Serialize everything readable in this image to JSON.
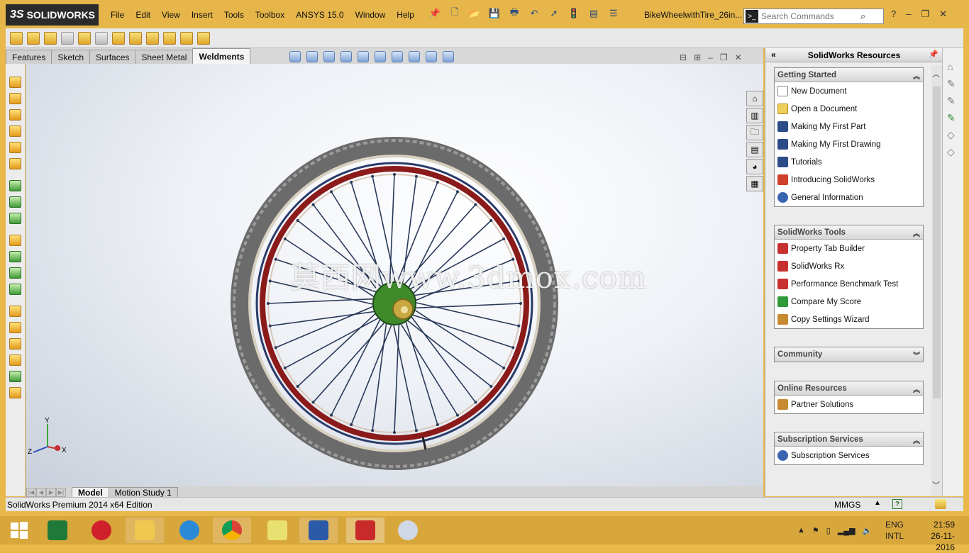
{
  "app": {
    "logo_text": "SOLIDWORKS",
    "logo_mark": "3S",
    "doc_title": "BikeWheelwithTire_26in...",
    "search_placeholder": "Search Commands"
  },
  "menu": [
    "File",
    "Edit",
    "View",
    "Insert",
    "Tools",
    "Toolbox",
    "ANSYS 15.0",
    "Window",
    "Help"
  ],
  "command_tabs": [
    {
      "label": "Features",
      "active": false
    },
    {
      "label": "Sketch",
      "active": false
    },
    {
      "label": "Surfaces",
      "active": false
    },
    {
      "label": "Sheet Metal",
      "active": false
    },
    {
      "label": "Weldments",
      "active": true
    }
  ],
  "viewport": {
    "watermark": "莫西网www.3dmox.com",
    "triad": {
      "x": "X",
      "y": "Y",
      "z": "Z"
    }
  },
  "bottom_tabs": [
    {
      "label": "Model",
      "active": true
    },
    {
      "label": "Motion Study 1",
      "active": false
    }
  ],
  "task_pane": {
    "title": "SolidWorks Resources",
    "groups": [
      {
        "title": "Getting Started",
        "collapsed": false,
        "items": [
          {
            "label": "New Document",
            "icon": "new-document-icon"
          },
          {
            "label": "Open a Document",
            "icon": "open-folder-icon"
          },
          {
            "label": "Making My First Part",
            "icon": "graduation-cap-icon"
          },
          {
            "label": "Making My First Drawing",
            "icon": "graduation-cap-icon"
          },
          {
            "label": "Tutorials",
            "icon": "graduation-cap-icon"
          },
          {
            "label": "Introducing SolidWorks",
            "icon": "solidworks-icon"
          },
          {
            "label": "General Information",
            "icon": "info-icon"
          }
        ]
      },
      {
        "title": "SolidWorks Tools",
        "collapsed": false,
        "items": [
          {
            "label": "Property Tab Builder",
            "icon": "property-tab-icon"
          },
          {
            "label": "SolidWorks Rx",
            "icon": "rx-icon"
          },
          {
            "label": "Performance Benchmark Test",
            "icon": "benchmark-icon"
          },
          {
            "label": "Compare My Score",
            "icon": "compare-score-icon"
          },
          {
            "label": "Copy Settings Wizard",
            "icon": "copy-settings-icon"
          }
        ]
      },
      {
        "title": "Community",
        "collapsed": true,
        "items": []
      },
      {
        "title": "Online Resources",
        "collapsed": false,
        "items": [
          {
            "label": "Partner Solutions",
            "icon": "partner-icon"
          }
        ]
      },
      {
        "title": "Subscription Services",
        "collapsed": false,
        "items": [
          {
            "label": "Subscription Services",
            "icon": "subscription-icon"
          }
        ]
      }
    ]
  },
  "status": {
    "text": "SolidWorks Premium 2014 x64 Edition",
    "units": "MMGS",
    "help_glyph": "?"
  },
  "taskbar": {
    "lang_top": "ENG",
    "lang_bottom": "INTL",
    "time": "21:59",
    "date": "26-11-2016",
    "apps": [
      "windows-start",
      "excel",
      "opera",
      "file-explorer",
      "internet-explorer",
      "chrome",
      "sticky-notes",
      "word",
      "solidworks",
      "paint"
    ]
  },
  "colors": {
    "frame": "#e8b94a",
    "taskbar": "#d8a73c",
    "rim": "#8b1a1a",
    "tire": "#6b6b6b",
    "spoke": "#2a3a5a",
    "hub": "#3f8a2a"
  }
}
